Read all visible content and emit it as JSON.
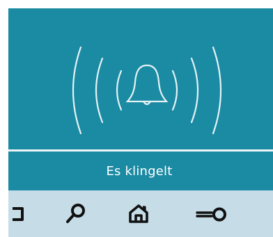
{
  "status": {
    "message": "Es klingelt"
  },
  "colors": {
    "panel": "#1b8aa3",
    "divider": "#eef4f7",
    "nav_background": "#c6dde8",
    "icon_dark": "#111111",
    "graphic_stroke": "#e6f3f6"
  },
  "alert": {
    "icon": "ringing-bell-icon"
  },
  "nav": {
    "items": [
      {
        "name": "partial-item-icon"
      },
      {
        "name": "search-icon"
      },
      {
        "name": "home-icon"
      },
      {
        "name": "key-icon"
      }
    ]
  }
}
